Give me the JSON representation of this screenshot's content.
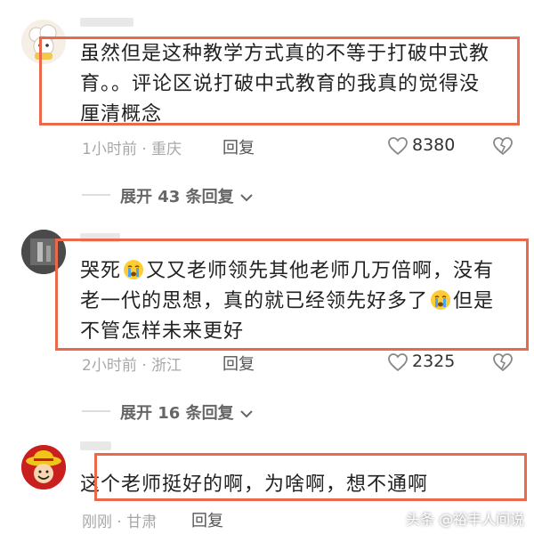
{
  "colors": {
    "highlight": "#e9694a",
    "meta": "#a8a8a8",
    "text": "#222222"
  },
  "comments": [
    {
      "avatar_icon": "sheep-avatar-icon",
      "lines": [
        "虽然但是这种教学方式真的不等于打破中式教",
        "育。。评论区说打破中式教育的我真的觉得没",
        "厘清概念"
      ],
      "time": "1小时前",
      "location": "重庆",
      "reply_label": "回复",
      "likes": "8380",
      "expand_label": "展开 43 条回复"
    },
    {
      "avatar_icon": "dark-photo-avatar-icon",
      "line1_a": "哭死",
      "line1_b": "又又老师领先其他老师几万倍啊，没有",
      "line2_a": "老一代的思想，真的就已经领先好多了",
      "line2_b": "但是",
      "line3": "不管怎样未来更好",
      "time": "2小时前",
      "location": "浙江",
      "reply_label": "回复",
      "likes": "2325",
      "expand_label": "展开 16 条回复"
    },
    {
      "avatar_icon": "straw-hat-avatar-icon",
      "text": "这个老师挺好的啊，为啥啊，想不通啊",
      "time": "刚刚",
      "location": "甘肃",
      "reply_label": "回复"
    }
  ],
  "watermark": "头条 @裕丰人间说",
  "icons": {
    "like": "heart-outline-icon",
    "dislike": "broken-heart-icon",
    "expand": "chevron-down-icon",
    "emoji": "crying-face-emoji-icon"
  }
}
